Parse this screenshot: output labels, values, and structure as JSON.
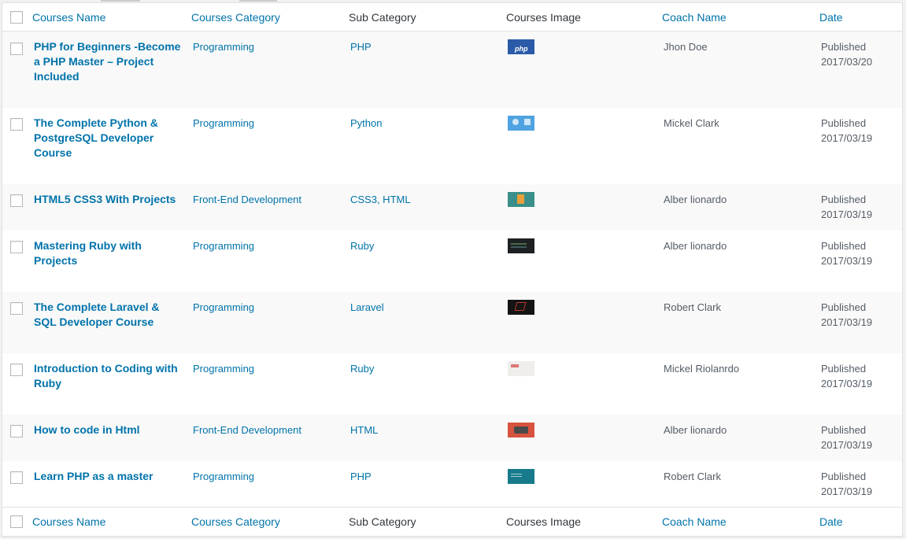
{
  "columns": {
    "name": "Courses Name",
    "category": "Courses Category",
    "subcategory": "Sub Category",
    "image": "Courses Image",
    "coach": "Coach Name",
    "date": "Date"
  },
  "rows": [
    {
      "title": "PHP for Beginners -Become a PHP Master – Project Included",
      "category": "Programming",
      "subcategory": "PHP",
      "image_icon": "php-course-thumbnail",
      "coach": "Jhon Doe",
      "status": "Published",
      "date": "2017/03/20"
    },
    {
      "title": "The Complete Python & PostgreSQL Developer Course",
      "category": "Programming",
      "subcategory": "Python",
      "image_icon": "python-postgresql-thumbnail",
      "coach": "Mickel Clark",
      "status": "Published",
      "date": "2017/03/19"
    },
    {
      "title": "HTML5 CSS3 With Projects",
      "category": "Front-End Development",
      "subcategory": "CSS3, HTML",
      "image_icon": "html5-css3-thumbnail",
      "coach": "Alber lionardo",
      "status": "Published",
      "date": "2017/03/19"
    },
    {
      "title": "Mastering Ruby with Projects",
      "category": "Programming",
      "subcategory": "Ruby",
      "image_icon": "ruby-code-thumbnail",
      "coach": "Alber lionardo",
      "status": "Published",
      "date": "2017/03/19"
    },
    {
      "title": "The Complete Laravel & SQL Developer Course",
      "category": "Programming",
      "subcategory": "Laravel",
      "image_icon": "laravel-thumbnail",
      "coach": "Robert Clark",
      "status": "Published",
      "date": "2017/03/19"
    },
    {
      "title": "Introduction to Coding with Ruby",
      "category": "Programming",
      "subcategory": "Ruby",
      "image_icon": "coding-ruby-thumbnail",
      "coach": "Mickel Riolanrdo",
      "status": "Published",
      "date": "2017/03/19"
    },
    {
      "title": "How to code in Html",
      "category": "Front-End Development",
      "subcategory": "HTML",
      "image_icon": "html-code-thumbnail",
      "coach": "Alber lionardo",
      "status": "Published",
      "date": "2017/03/19"
    },
    {
      "title": "Learn PHP as a master",
      "category": "Programming",
      "subcategory": "PHP",
      "image_icon": "learn-php-thumbnail",
      "coach": "Robert Clark",
      "status": "Published",
      "date": "2017/03/19"
    }
  ],
  "colors": {
    "link": "#0073aa",
    "text": "#555d66",
    "alt_row": "#f9f9f9",
    "border": "#e1e1e1"
  }
}
